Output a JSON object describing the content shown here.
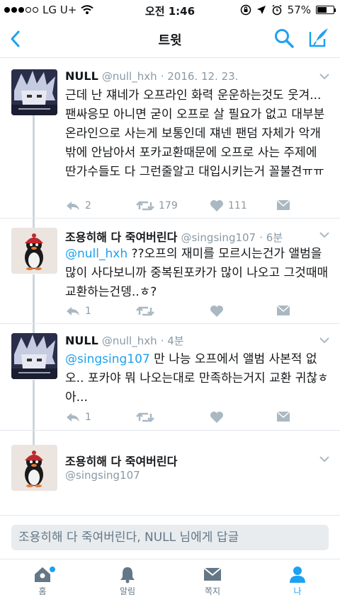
{
  "status": {
    "carrier": "LG U+",
    "time": "오전 1:46",
    "battery": "57%",
    "battery_level": 0.57
  },
  "nav": {
    "title": "트윗"
  },
  "tweets": [
    {
      "name": "NULL",
      "handle": "@null_hxh",
      "time": "· 2016. 12. 23.",
      "mention": "",
      "text": "근데 난 쟤네가 오프라인 화력 운운하는것도 웃겨... 팬싸응모 아니면 굳이 오프로 살 필요가 없고 대부분 온라인으로 사는게 보통인데 쟤넨 팬덤 자체가 악개밖에 안남아서 포카교환때문에 오프로 사는 주제에 딴가수들도 다 그런줄알고 대입시키는거 꼴불견ㅠㅠ",
      "replies": "2",
      "retweets": "179",
      "likes": "111"
    },
    {
      "name": "조용히해 다 죽여버린다",
      "handle": "@singsing107",
      "time": "· 6분",
      "mention": "@null_hxh",
      "text": " ??오프의 재미를 모르시는건가 앨범을 많이 사다보니까 중복된포카가 많이 나오고 그것때매 교환하는건뎅..ㅎ?",
      "replies": "1",
      "retweets": "",
      "likes": ""
    },
    {
      "name": "NULL",
      "handle": "@null_hxh",
      "time": "· 4분",
      "mention": "@singsing107",
      "text": " 만 나능 오프에서 앨범 사본적 없오.. 포카야 뭐 나오는대로 만족하는거지 교환 귀찮ㅎ아...",
      "replies": "1",
      "retweets": "",
      "likes": ""
    }
  ],
  "current_user": {
    "name": "조용히해 다 죽여버린다",
    "handle": "@singsing107"
  },
  "reply": {
    "placeholder": "조용히해 다 죽여버린다, NULL 님에게 답글"
  },
  "tabs": [
    {
      "label": "홈",
      "icon": "home-icon"
    },
    {
      "label": "알림",
      "icon": "bell-icon"
    },
    {
      "label": "쪽지",
      "icon": "envelope-icon"
    },
    {
      "label": "나",
      "icon": "person-icon"
    }
  ],
  "colors": {
    "accent": "#1da1f2",
    "muted": "#8899a6",
    "divider": "#e1e8ed"
  }
}
